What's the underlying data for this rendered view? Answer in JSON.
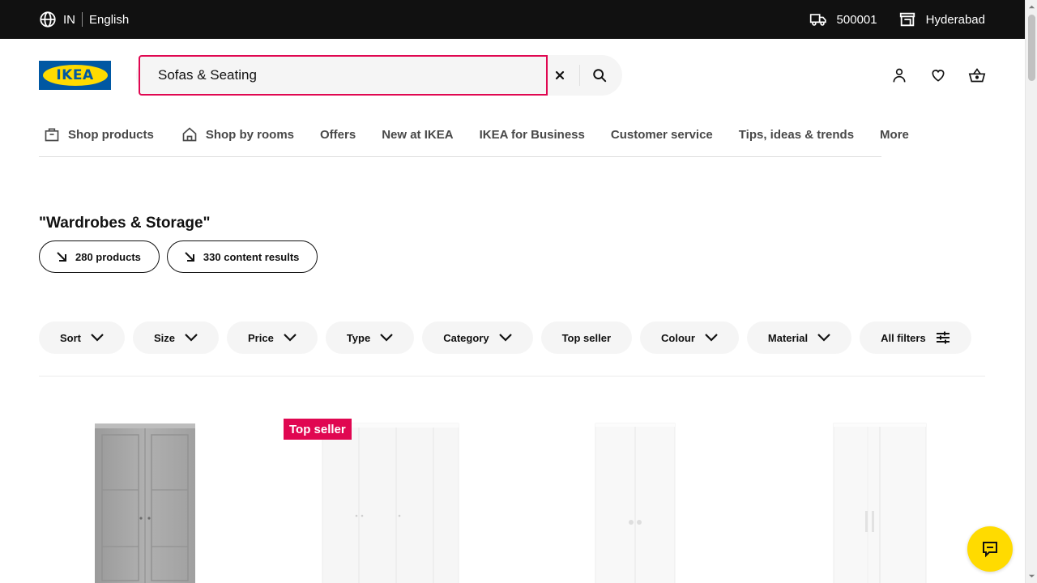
{
  "topbar": {
    "country": "IN",
    "language": "English",
    "pincode": "500001",
    "city": "Hyderabad"
  },
  "logo": {
    "text": "IKEA"
  },
  "search": {
    "value": "Sofas & Seating",
    "placeholder": "What are you looking for?"
  },
  "nav": {
    "items": [
      {
        "label": "Shop products"
      },
      {
        "label": "Shop by rooms"
      },
      {
        "label": "Offers"
      },
      {
        "label": "New at IKEA"
      },
      {
        "label": "IKEA for Business"
      },
      {
        "label": "Customer service"
      },
      {
        "label": "Tips, ideas & trends"
      },
      {
        "label": "More"
      }
    ]
  },
  "results": {
    "query_title": "\"Wardrobes & Storage\"",
    "products_pill": "280 products",
    "content_pill": "330 content results"
  },
  "filters": {
    "items": [
      {
        "label": "Sort"
      },
      {
        "label": "Size"
      },
      {
        "label": "Price"
      },
      {
        "label": "Type"
      },
      {
        "label": "Category"
      },
      {
        "label": "Top seller"
      },
      {
        "label": "Colour"
      },
      {
        "label": "Material"
      },
      {
        "label": "All filters"
      }
    ]
  },
  "products": {
    "badge": "Top seller"
  },
  "colors": {
    "topbar": "#111111",
    "ikea_blue": "#0058a3",
    "ikea_yellow": "#ffdb00",
    "badge_red": "#e00751",
    "chip_bg": "#f5f5f5"
  },
  "icons": [
    "globe-icon",
    "truck-icon",
    "store-icon",
    "close-icon",
    "search-icon",
    "user-icon",
    "heart-icon",
    "basket-icon",
    "chevron-down-icon",
    "arrow-down-right-icon",
    "filter-sliders-icon",
    "chat-icon"
  ]
}
